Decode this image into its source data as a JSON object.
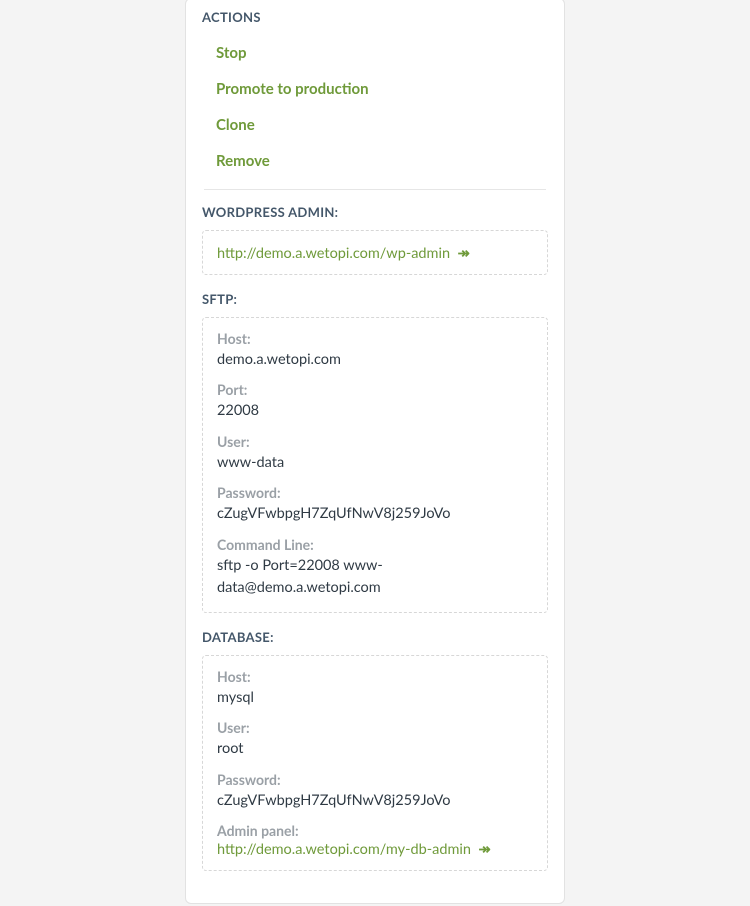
{
  "actions": {
    "header": "ACTIONS",
    "items": [
      "Stop",
      "Promote to production",
      "Clone",
      "Remove"
    ]
  },
  "wp_admin": {
    "header": "WORDPRESS ADMIN:",
    "url": "http://demo.a.wetopi.com/wp-admin"
  },
  "sftp": {
    "header": "SFTP:",
    "host_label": "Host:",
    "host": "demo.a.wetopi.com",
    "port_label": "Port:",
    "port": "22008",
    "user_label": "User:",
    "user": "www-data",
    "password_label": "Password:",
    "password": "cZugVFwbpgH7ZqUfNwV8j259JoVo",
    "cmd_label": "Command Line:",
    "cmd": "sftp -o Port=22008 www-data@demo.a.wetopi.com"
  },
  "database": {
    "header": "DATABASE:",
    "host_label": "Host:",
    "host": "mysql",
    "user_label": "User:",
    "user": "root",
    "password_label": "Password:",
    "password": "cZugVFwbpgH7ZqUfNwV8j259JoVo",
    "admin_label": "Admin panel:",
    "admin_url": "http://demo.a.wetopi.com/my-db-admin"
  }
}
